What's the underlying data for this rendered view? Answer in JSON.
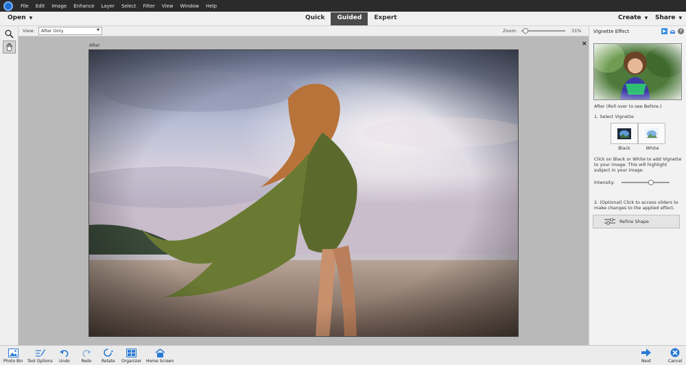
{
  "menubar": {
    "items": [
      "File",
      "Edit",
      "Image",
      "Enhance",
      "Layer",
      "Select",
      "Filter",
      "View",
      "Window",
      "Help"
    ]
  },
  "modebar": {
    "open_label": "Open",
    "modes": [
      "Quick",
      "Guided",
      "Expert"
    ],
    "active_mode": "Guided",
    "create_label": "Create",
    "share_label": "Share"
  },
  "options": {
    "view_label": "View:",
    "view_value": "After Only",
    "zoom_label": "Zoom:",
    "zoom_value": "31%",
    "zoom_fraction": 0.1
  },
  "canvas": {
    "label": "After",
    "close_glyph": "×"
  },
  "panel": {
    "title": "Vignette Effect",
    "after_caption": "After (Roll over to see Before.)",
    "step1": "1. Select Vignette",
    "black_label": "Black",
    "white_label": "White",
    "help_text": "Click on Black or White to add Vignette to your image. This will highlight subject in your image.",
    "intensity_label": "Intensity:",
    "intensity_fraction": 0.62,
    "step2": "2. (Optional) Click to access sliders to make changes to the applied effect.",
    "refine_label": "Refine Shape"
  },
  "bottombar": {
    "photo_bin": "Photo Bin",
    "tool_options": "Tool Options",
    "undo": "Undo",
    "redo": "Redo",
    "rotate": "Rotate",
    "organizer": "Organizer",
    "home_screen": "Home Screen",
    "next": "Next",
    "cancel": "Cancel"
  },
  "colors": {
    "accent_blue": "#2a7ad5",
    "menubar_bg": "#2b2b2b",
    "active_tab_bg": "#4a4a4a"
  }
}
